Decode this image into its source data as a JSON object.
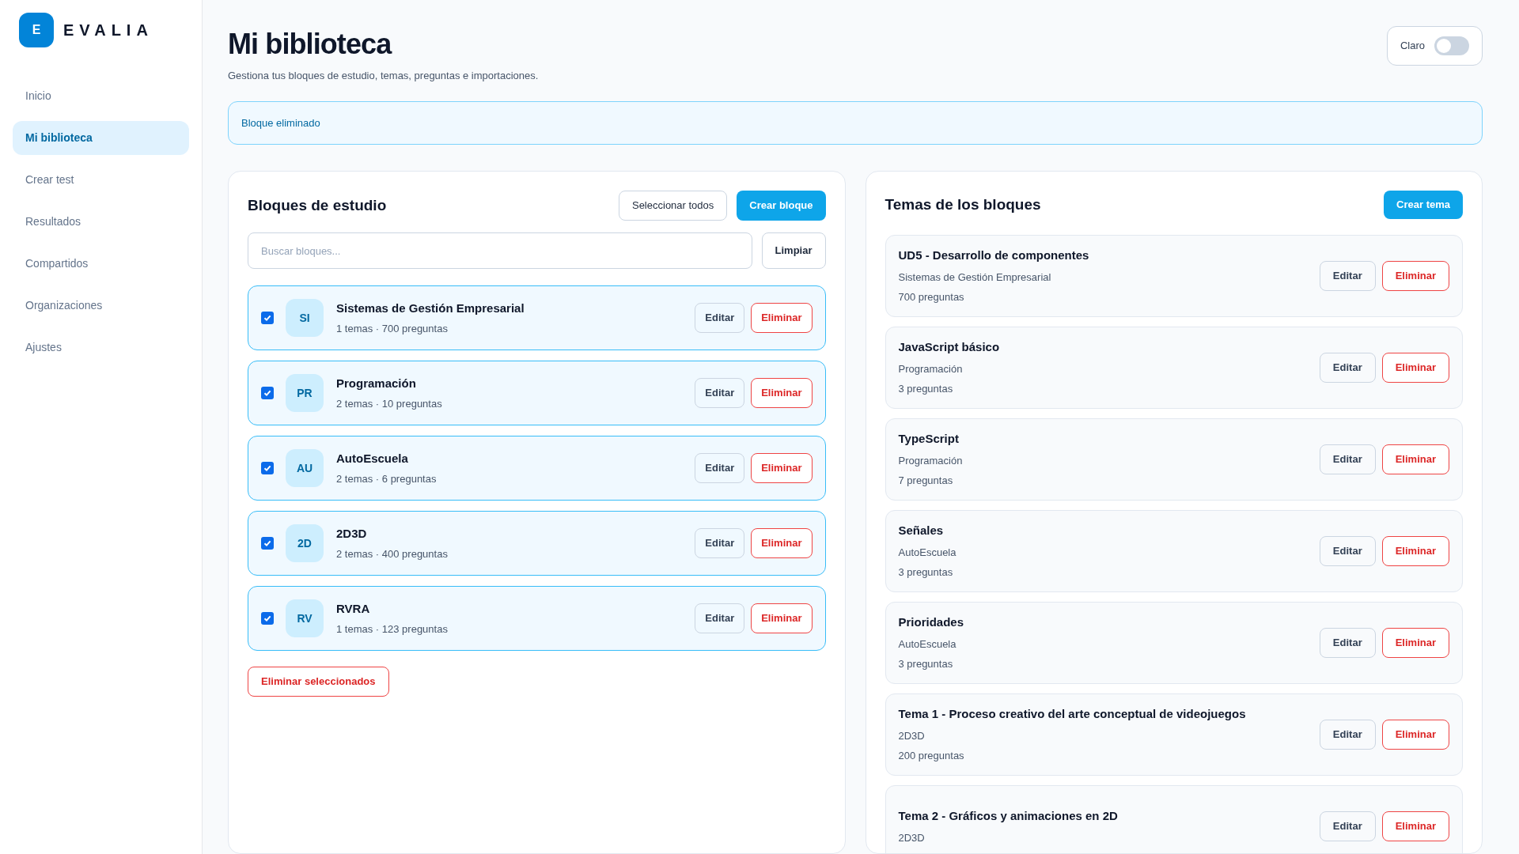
{
  "brand": {
    "logo_letter": "E",
    "name": "EVALIA"
  },
  "sidebar": {
    "items": [
      {
        "label": "Inicio",
        "selected": false
      },
      {
        "label": "Mi biblioteca",
        "selected": true
      },
      {
        "label": "Crear test",
        "selected": false
      },
      {
        "label": "Resultados",
        "selected": false
      },
      {
        "label": "Compartidos",
        "selected": false
      },
      {
        "label": "Organizaciones",
        "selected": false
      },
      {
        "label": "Ajustes",
        "selected": false
      }
    ]
  },
  "header": {
    "title": "Mi biblioteca",
    "subtitle": "Gestiona tus bloques de estudio, temas, preguntas e importaciones.",
    "theme_toggle": {
      "label": "Claro",
      "on": false
    }
  },
  "alert": "Bloque eliminado",
  "blocks_panel": {
    "title": "Bloques de estudio",
    "select_all": "Seleccionar todos",
    "create": "Crear bloque",
    "search": {
      "placeholder": "Buscar bloques..."
    },
    "clear": "Limpiar",
    "blocks": [
      {
        "initials": "SI",
        "name": "Sistemas de Gestión Empresarial",
        "meta": "1 temas · 700 preguntas",
        "checked": true,
        "edit": "Editar",
        "delete": "Eliminar"
      },
      {
        "initials": "PR",
        "name": "Programación",
        "meta": "2 temas · 10 preguntas",
        "checked": true,
        "edit": "Editar",
        "delete": "Eliminar"
      },
      {
        "initials": "AU",
        "name": "AutoEscuela",
        "meta": "2 temas · 6 preguntas",
        "checked": true,
        "edit": "Editar",
        "delete": "Eliminar"
      },
      {
        "initials": "2D",
        "name": "2D3D",
        "meta": "2 temas · 400 preguntas",
        "checked": true,
        "edit": "Editar",
        "delete": "Eliminar"
      },
      {
        "initials": "RV",
        "name": "RVRA",
        "meta": "1 temas · 123 preguntas",
        "checked": true,
        "edit": "Editar",
        "delete": "Eliminar"
      }
    ],
    "delete_selected": "Eliminar seleccionados"
  },
  "topics_panel": {
    "title": "Temas de los bloques",
    "create": "Crear tema",
    "topics": [
      {
        "name": "UD5 - Desarrollo de componentes",
        "block": "Sistemas de Gestión Empresarial",
        "count": "700 preguntas",
        "edit": "Editar",
        "delete": "Eliminar"
      },
      {
        "name": "JavaScript básico",
        "block": "Programación",
        "count": "3 preguntas",
        "edit": "Editar",
        "delete": "Eliminar"
      },
      {
        "name": "TypeScript",
        "block": "Programación",
        "count": "7 preguntas",
        "edit": "Editar",
        "delete": "Eliminar"
      },
      {
        "name": "Señales",
        "block": "AutoEscuela",
        "count": "3 preguntas",
        "edit": "Editar",
        "delete": "Eliminar"
      },
      {
        "name": "Prioridades",
        "block": "AutoEscuela",
        "count": "3 preguntas",
        "edit": "Editar",
        "delete": "Eliminar"
      },
      {
        "name": "Tema 1 - Proceso creativo del arte conceptual de videojuegos",
        "block": "2D3D",
        "count": "200 preguntas",
        "edit": "Editar",
        "delete": "Eliminar"
      },
      {
        "name": "Tema 2 - Gráficos y animaciones en 2D",
        "block": "2D3D",
        "edit": "Editar",
        "delete": "Eliminar"
      }
    ]
  }
}
